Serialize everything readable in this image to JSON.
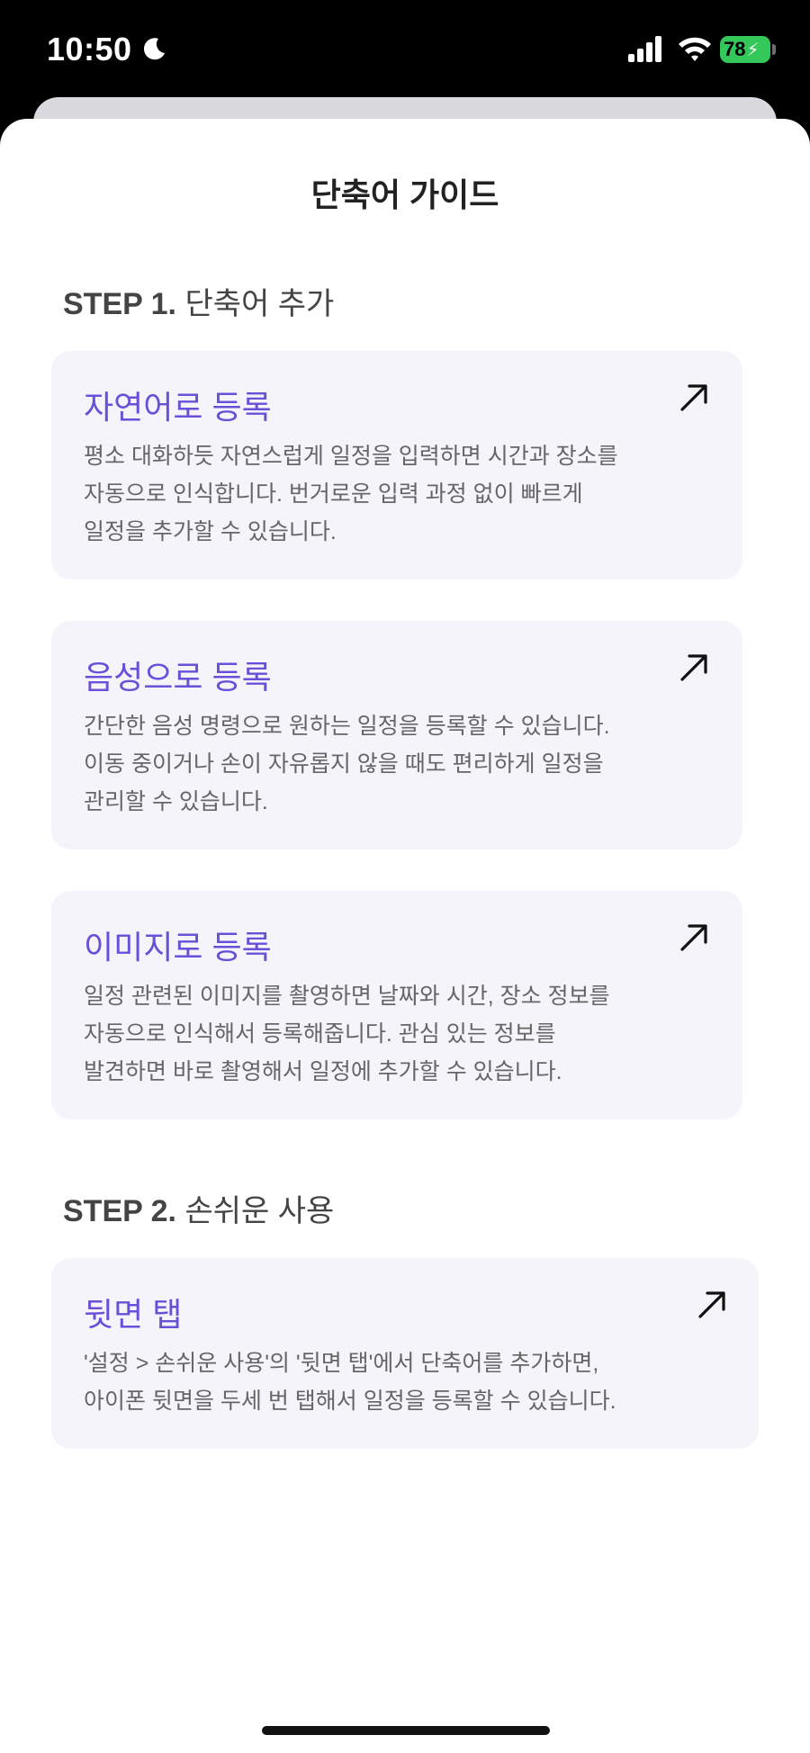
{
  "status_bar": {
    "time": "10:50",
    "battery": "78",
    "icons": [
      "moon-icon",
      "cellular-signal-icon",
      "wifi-icon",
      "battery-icon"
    ]
  },
  "sheet": {
    "title": "단축어 가이드"
  },
  "steps": [
    {
      "prefix": "STEP 1.",
      "label": "단축어 추가",
      "cards": [
        {
          "title": "자연어로 등록",
          "description": "평소 대화하듯 자연스럽게 일정을 입력하면 시간과 장소를\n자동으로 인식합니다. 번거로운 입력 과정 없이 빠르게\n일정을 추가할 수 있습니다."
        },
        {
          "title": "음성으로 등록",
          "description": "간단한 음성 명령으로 원하는 일정을 등록할 수 있습니다.\n이동 중이거나 손이 자유롭지 않을 때도 편리하게 일정을\n관리할 수 있습니다."
        },
        {
          "title": "이미지로 등록",
          "description": "일정 관련된 이미지를 촬영하면 날짜와 시간, 장소 정보를\n자동으로 인식해서 등록해줍니다. 관심 있는 정보를\n발견하면 바로 촬영해서 일정에 추가할 수 있습니다."
        }
      ]
    },
    {
      "prefix": "STEP 2.",
      "label": "손쉬운 사용",
      "cards": [
        {
          "title": "뒷면 탭",
          "description": "'설정 > 손쉬운 사용'의 '뒷면 탭'에서 단축어를 추가하면,\n아이폰 뒷면을 두세 번 탭해서 일정을 등록할 수 있습니다."
        }
      ]
    }
  ],
  "colors": {
    "accent": "#6a50d8",
    "card_background": "#f5f4fb",
    "battery": "#34c759"
  }
}
